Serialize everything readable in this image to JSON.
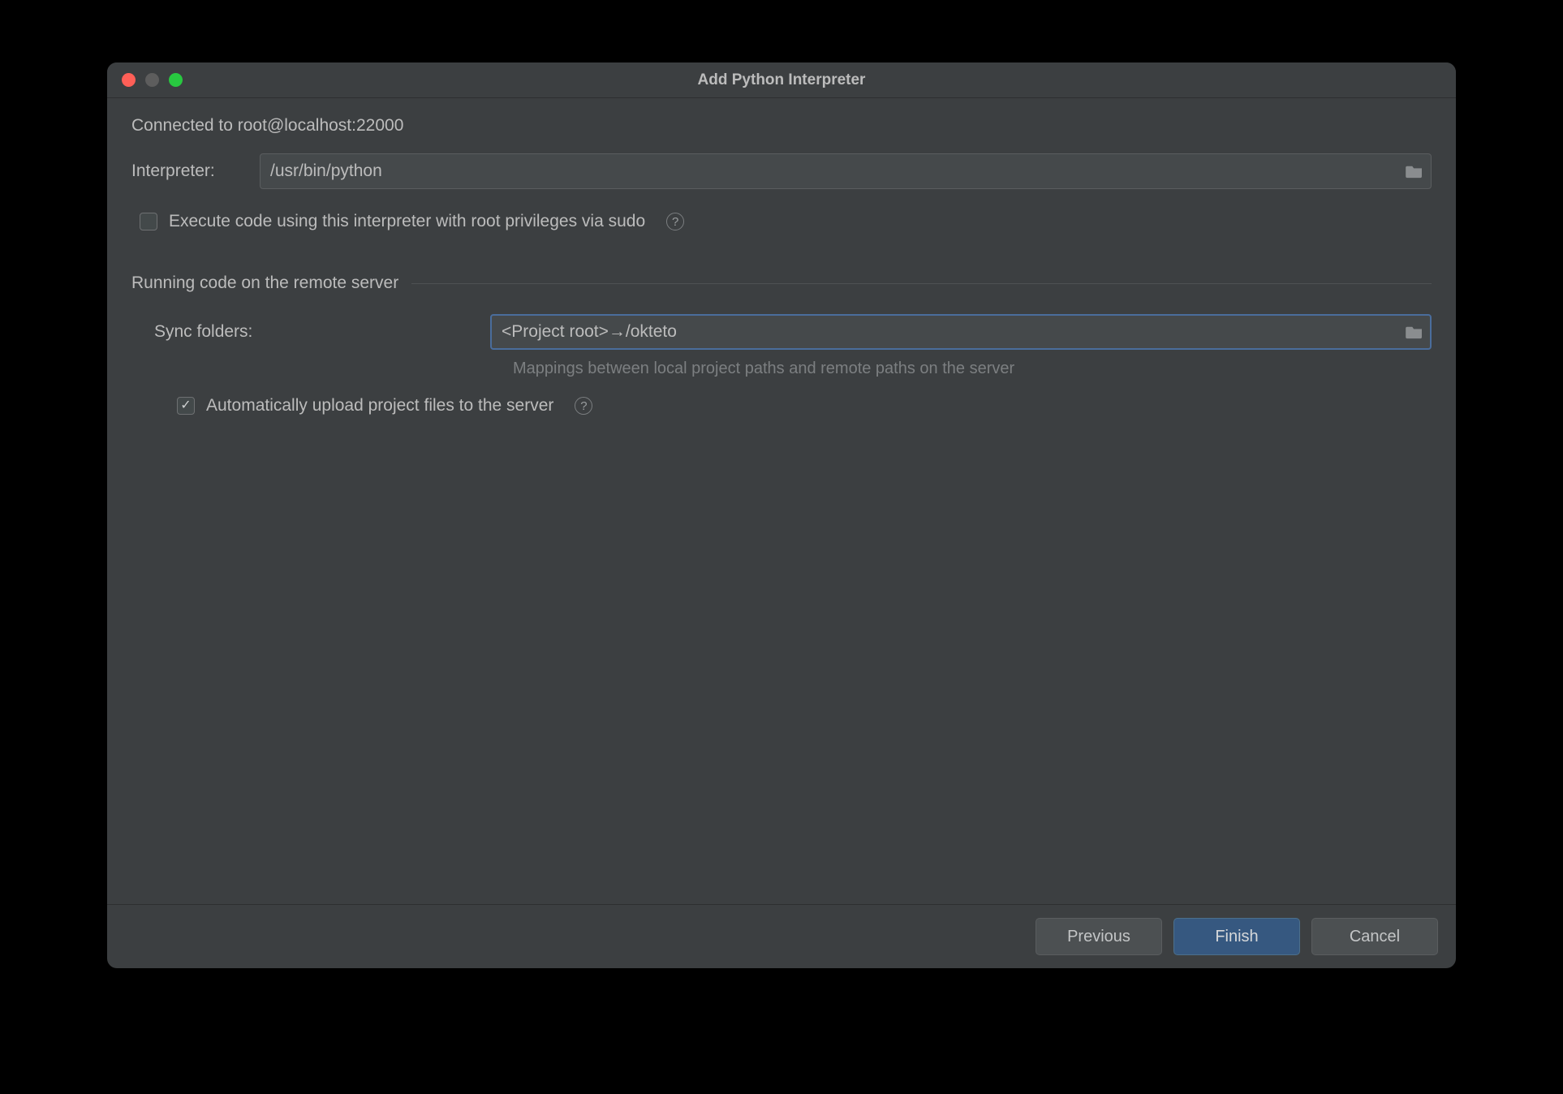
{
  "window": {
    "title": "Add Python Interpreter"
  },
  "status": "Connected to root@localhost:22000",
  "interpreter": {
    "label": "Interpreter:",
    "value": "/usr/bin/python"
  },
  "sudo": {
    "label": "Execute code using this interpreter with root privileges via sudo",
    "checked": false
  },
  "section": {
    "title": "Running code on the remote server"
  },
  "sync": {
    "label": "Sync folders:",
    "value": "<Project root>→/okteto",
    "hint": "Mappings between local project paths and remote paths on the server"
  },
  "auto_upload": {
    "label": "Automatically upload project files to the server",
    "checked": true
  },
  "buttons": {
    "previous": "Previous",
    "finish": "Finish",
    "cancel": "Cancel"
  }
}
